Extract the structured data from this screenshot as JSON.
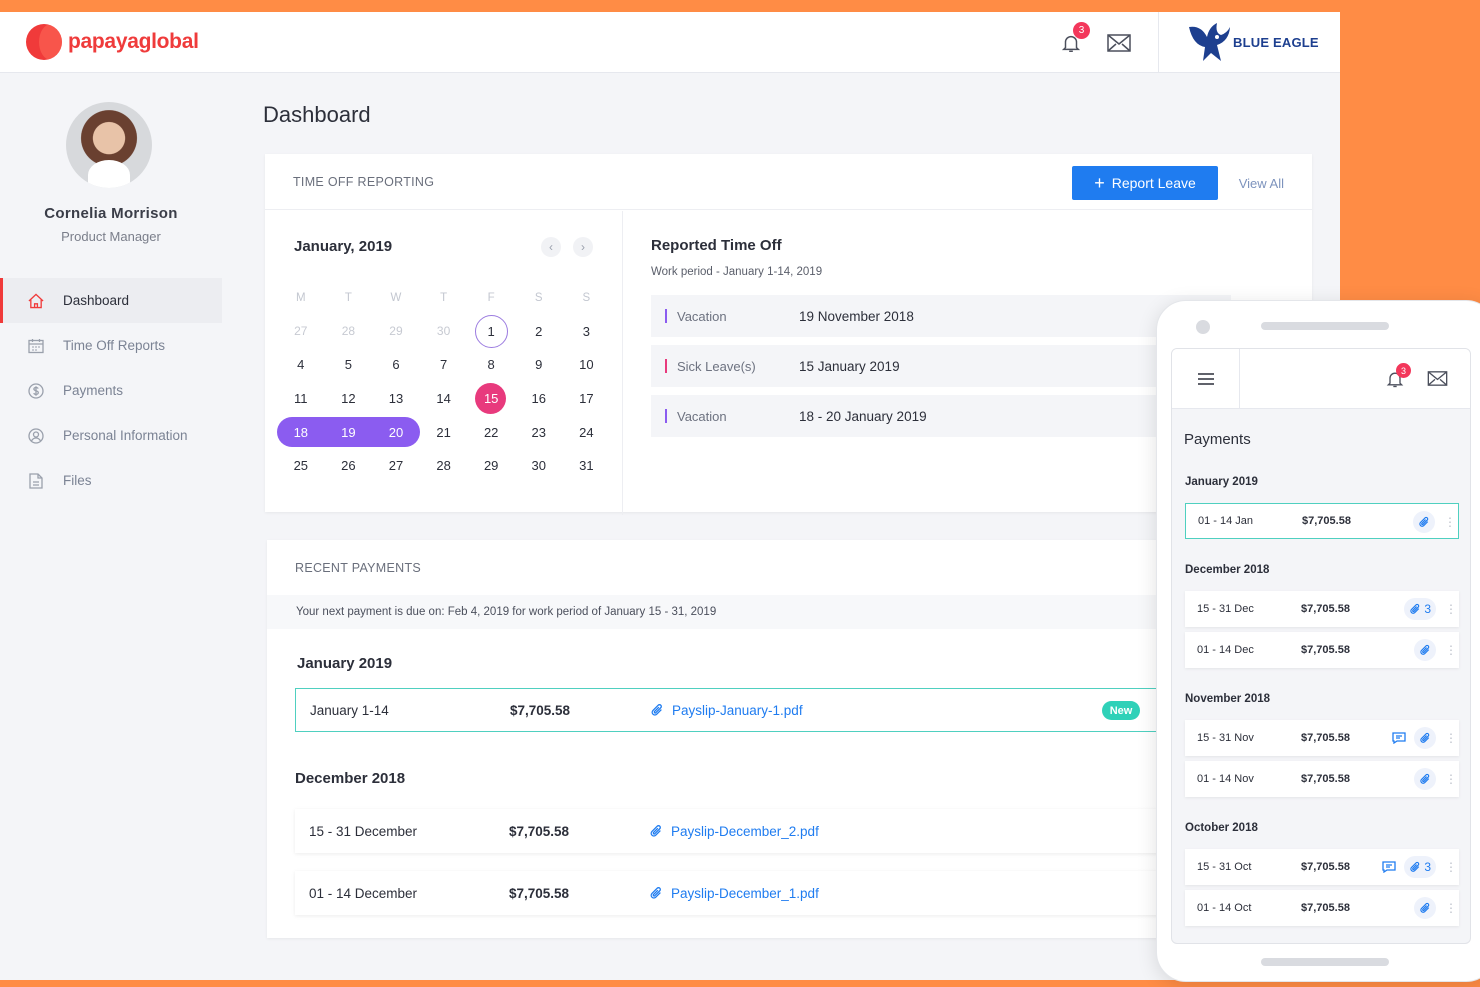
{
  "header": {
    "logo_text": "papayaglobal",
    "notification_count": "3",
    "brand_name": "BLUE EAGLE",
    "colors": {
      "accent": "#1f7cf0",
      "logo": "#ef3b3b",
      "badge": "#f3375b",
      "background": "#ff8c45"
    }
  },
  "user": {
    "name": "Cornelia Morrison",
    "role": "Product Manager"
  },
  "nav": {
    "items": [
      {
        "label": "Dashboard",
        "icon": "home-icon",
        "active": true
      },
      {
        "label": "Time Off Reports",
        "icon": "calendar-icon",
        "active": false
      },
      {
        "label": "Payments",
        "icon": "dollar-icon",
        "active": false
      },
      {
        "label": "Personal Information",
        "icon": "user-icon",
        "active": false
      },
      {
        "label": "Files",
        "icon": "file-icon",
        "active": false
      }
    ]
  },
  "page": {
    "title": "Dashboard"
  },
  "time_off": {
    "header": "TIME OFF REPORTING",
    "report_button": "Report Leave",
    "view_all": "View All",
    "calendar": {
      "title": "January, 2019",
      "weekdays": [
        "M",
        "T",
        "W",
        "T",
        "F",
        "S",
        "S"
      ],
      "weeks": [
        [
          "27",
          "28",
          "29",
          "30",
          "1",
          "2",
          "3"
        ],
        [
          "4",
          "5",
          "6",
          "7",
          "8",
          "9",
          "10"
        ],
        [
          "11",
          "12",
          "13",
          "14",
          "15",
          "16",
          "17"
        ],
        [
          "18",
          "19",
          "20",
          "21",
          "22",
          "23",
          "24"
        ],
        [
          "25",
          "26",
          "27",
          "28",
          "29",
          "30",
          "31"
        ]
      ]
    },
    "reported": {
      "title": "Reported Time Off",
      "subtitle": "Work period - January 1-14, 2019",
      "rows": [
        {
          "type": "Vacation",
          "date": "19 November 2018",
          "color": "#8b5cf0"
        },
        {
          "type": "Sick Leave(s)",
          "date": "15 January 2019",
          "color": "#e83a7d"
        },
        {
          "type": "Vacation",
          "date": "18 - 20 January 2019",
          "color": "#8b5cf0"
        }
      ]
    }
  },
  "payments": {
    "header": "RECENT PAYMENTS",
    "note": "Your next payment is due on: Feb 4, 2019 for work period of January 15 - 31, 2019",
    "groups": [
      {
        "month": "January 2019",
        "rows": [
          {
            "period": "January 1-14",
            "amount": "$7,705.58",
            "file": "Payslip-January-1.pdf",
            "badge": "New"
          }
        ]
      },
      {
        "month": "December 2018",
        "rows": [
          {
            "period": "15 - 31 December",
            "amount": "$7,705.58",
            "file": "Payslip-December_2.pdf"
          },
          {
            "period": "01 - 14 December",
            "amount": "$7,705.58",
            "file": "Payslip-December_1.pdf"
          }
        ]
      }
    ]
  },
  "mobile": {
    "notification_count": "3",
    "title": "Payments",
    "groups": [
      {
        "month": "January 2019",
        "rows": [
          {
            "period": "01 - 14 Jan",
            "amount": "$7,705.58",
            "attachments": ""
          }
        ]
      },
      {
        "month": "December 2018",
        "rows": [
          {
            "period": "15 - 31 Dec",
            "amount": "$7,705.58",
            "attachments": "3"
          },
          {
            "period": "01 - 14 Dec",
            "amount": "$7,705.58",
            "attachments": ""
          }
        ]
      },
      {
        "month": "November 2018",
        "rows": [
          {
            "period": "15 - 31 Nov",
            "amount": "$7,705.58",
            "attachments": ""
          },
          {
            "period": "01 - 14 Nov",
            "amount": "$7,705.58",
            "attachments": ""
          }
        ]
      },
      {
        "month": "October 2018",
        "rows": [
          {
            "period": "15 - 31 Oct",
            "amount": "$7,705.58",
            "attachments": "3"
          },
          {
            "period": "01 - 14 Oct",
            "amount": "$7,705.58",
            "attachments": ""
          }
        ]
      }
    ]
  }
}
